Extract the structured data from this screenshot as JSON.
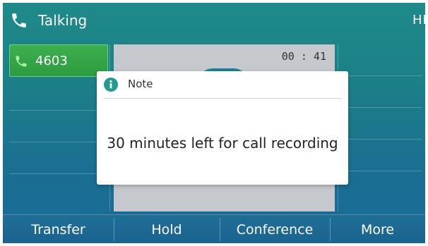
{
  "status_bar": {
    "title": "Talking",
    "hd_label": "HD"
  },
  "line_key": {
    "label": "4603"
  },
  "call": {
    "timer": "00 : 41"
  },
  "dialog": {
    "title": "Note",
    "message": "30 minutes left for call recording"
  },
  "softkeys": [
    {
      "label": "Transfer"
    },
    {
      "label": "Hold"
    },
    {
      "label": "Conference"
    },
    {
      "label": "More"
    }
  ],
  "colors": {
    "background": "#1c7f88",
    "line_key": "#2e9b40",
    "call_panel": "#c5c8cc",
    "dialog_icon": "#1f9c8f",
    "softkey_bar": "#1b6290"
  }
}
